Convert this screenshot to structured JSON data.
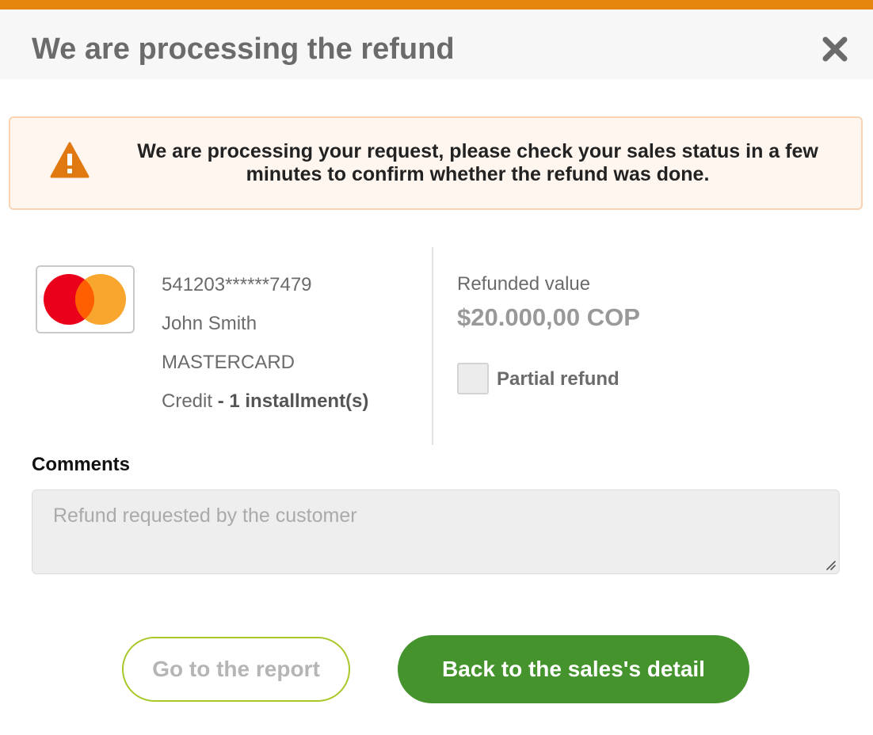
{
  "header": {
    "title": "We are processing the refund",
    "close_icon": "close-icon",
    "accent_color": "#e5870f"
  },
  "alert": {
    "icon": "warning-icon",
    "message": "We are processing your request, please check your sales status in a few minutes to confirm whether the refund was done.",
    "icon_color": "#e07a10",
    "background": "#fff6ef",
    "border": "#f9d3b2"
  },
  "card": {
    "brand_icon": "mastercard-logo-icon",
    "number": "541203******7479",
    "holder": "John Smith",
    "brand": "MASTERCARD",
    "type": "Credit",
    "installments": " - 1 installment(s)"
  },
  "refund": {
    "label": "Refunded value",
    "value": "$20.000,00 COP",
    "partial_label": "Partial refund",
    "partial_checked": false
  },
  "comments": {
    "label": "Comments",
    "placeholder": "Refund requested by the customer",
    "value": ""
  },
  "actions": {
    "report_label": "Go to the report",
    "back_label": "Back to the sales's detail",
    "primary_color": "#45932c",
    "outline_color": "#a8c82a"
  }
}
